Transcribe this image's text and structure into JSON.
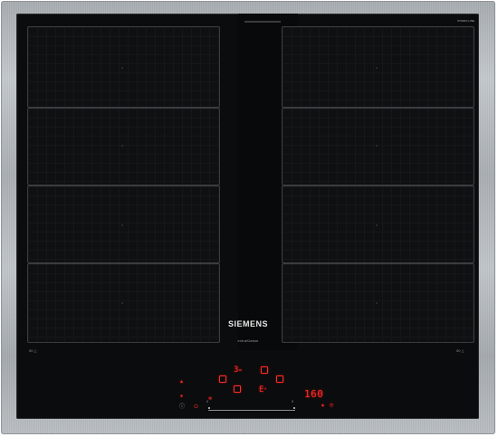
{
  "brand": {
    "name": "SIEMENS",
    "sub": "extraKlasse"
  },
  "top_logo": {
    "text": "STUDIO LINE"
  },
  "zones": {
    "left_side_label": "00 △",
    "right_side_label": "00 △"
  },
  "control_panel": {
    "left_display": "3",
    "left_display_suffix": "≈",
    "right_display": "E",
    "right_display_suffix": "°",
    "timer_display": "160",
    "info_icon": "ⓘ",
    "power_icon": "⏻",
    "lock_icon": "🔒",
    "slider_left": "0",
    "slider_right": "9"
  },
  "colors": {
    "glass": "#0b0c0d",
    "frame": "#b3b8bc",
    "led": "#ff2a2a",
    "brand_text": "#e6e6e6"
  }
}
